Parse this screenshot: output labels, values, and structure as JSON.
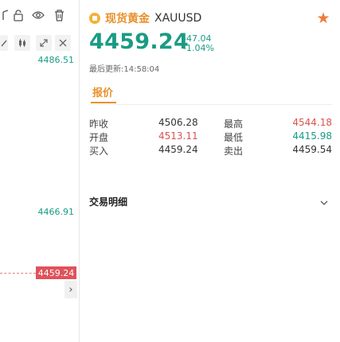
{
  "chart": {
    "price_ticks": [
      "4486.51",
      "4466.91"
    ],
    "current_price_tag": "4459.24",
    "expand_glyph": "›"
  },
  "quote": {
    "name": "现货黄金",
    "symbol": "XAUUSD",
    "price": "4459.24",
    "change": "-47.04",
    "change_pct": "-1.04%",
    "last_update": "最后更新:14:58:04",
    "tab": "报价",
    "stats": [
      {
        "label1": "昨收",
        "value1": "4506.28",
        "label2": "最高",
        "value2": "4544.18"
      },
      {
        "label1": "开盘",
        "value1": "4513.11",
        "label2": "最低",
        "value2": "4415.98"
      },
      {
        "label1": "买入",
        "value1": "4459.24",
        "label2": "卖出",
        "value2": "4459.54"
      }
    ],
    "details_label": "交易明细"
  },
  "colors": {
    "up": "#d9534f",
    "down": "#1a9b84",
    "accent": "#e9902b",
    "star": "#f07a39"
  },
  "icons": [
    "lock-icon",
    "eye-icon",
    "trash-icon",
    "star-icon",
    "chevron-down-icon",
    "gold-coin-icon"
  ]
}
